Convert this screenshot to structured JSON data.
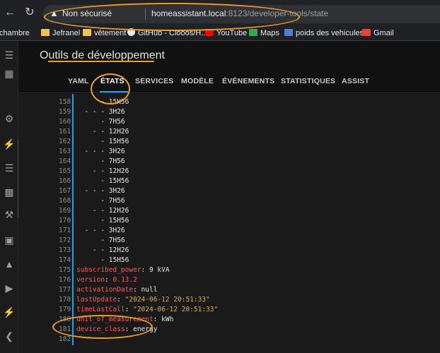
{
  "browser": {
    "back_icon": "arrow-left-icon",
    "reload_icon": "reload-icon",
    "security_label": "Non sécurisé",
    "url_host": "homeassistant.local",
    "url_rest": ":8123/developer-tools/state"
  },
  "bookmarks": [
    {
      "label": "chambre",
      "icon": "folder-icon"
    },
    {
      "label": "Jefranel",
      "icon": "folder-icon"
    },
    {
      "label": "vêtement",
      "icon": "folder-icon"
    },
    {
      "label": "GitHub - Clooos/H...",
      "icon": "github-icon"
    },
    {
      "label": "YouTube",
      "icon": "youtube-icon"
    },
    {
      "label": "Maps",
      "icon": "maps-icon"
    },
    {
      "label": "poids des vehicules...",
      "icon": "page-icon"
    },
    {
      "label": "Gmail",
      "icon": "gmail-icon"
    }
  ],
  "header": {
    "title": "Outils de développement"
  },
  "tabs": [
    {
      "label": "YAML"
    },
    {
      "label": "ÉTATS"
    },
    {
      "label": "SERVICES"
    },
    {
      "label": "MODÈLE"
    },
    {
      "label": "ÉVÉNEMENTS"
    },
    {
      "label": "STATISTIQUES"
    },
    {
      "label": "ASSIST"
    }
  ],
  "editor": {
    "lines": [
      {
        "n": "158",
        "text": "      - 15H56"
      },
      {
        "n": "159",
        "text": "  - - - 3H26"
      },
      {
        "n": "160",
        "text": "      - 7H56"
      },
      {
        "n": "161",
        "text": "    - - 12H26"
      },
      {
        "n": "162",
        "text": "      - 15H56"
      },
      {
        "n": "163",
        "text": "  - - - 3H26"
      },
      {
        "n": "164",
        "text": "      - 7H56"
      },
      {
        "n": "165",
        "text": "    - - 12H26"
      },
      {
        "n": "166",
        "text": "      - 15H56"
      },
      {
        "n": "167",
        "text": "  - - - 3H26"
      },
      {
        "n": "168",
        "text": "      - 7H56"
      },
      {
        "n": "169",
        "text": "    - - 12H26"
      },
      {
        "n": "170",
        "text": "      - 15H56"
      },
      {
        "n": "171",
        "text": "  - - - 3H26"
      },
      {
        "n": "172",
        "text": "      - 7H56"
      },
      {
        "n": "173",
        "text": "    - - 12H26"
      },
      {
        "n": "174",
        "text": "      - 15H56"
      },
      {
        "n": "175",
        "key": "subscribed_power",
        "value": " 9 kVA",
        "vtype": "plain"
      },
      {
        "n": "176",
        "key": "version",
        "value": " 0.13.2",
        "vtype": "key"
      },
      {
        "n": "177",
        "key": "activationDate",
        "value": " null",
        "vtype": "plain"
      },
      {
        "n": "178",
        "key": "lastUpdate",
        "value": " \"2024-06-12 20:51:33\"",
        "vtype": "str"
      },
      {
        "n": "179",
        "key": "timeLastCall",
        "value": " \"2024-06-12 20:51:33\"",
        "vtype": "str"
      },
      {
        "n": "180",
        "key": "unit_of_measurement",
        "value": " kWh",
        "vtype": "plain"
      },
      {
        "n": "181",
        "key": "device_class",
        "value": " energy",
        "vtype": "plain"
      },
      {
        "n": "182",
        "text": ""
      }
    ]
  },
  "sidebar": {
    "icons": [
      "menu-icon",
      "dashboard-icon",
      "settings-cog-icon",
      "puzzle-icon",
      "lightning-icon",
      "list-icon",
      "chart-icon",
      "wrench-icon",
      "hacs-icon",
      "history-icon",
      "media-icon",
      "energy-icon",
      "vscode-icon"
    ]
  }
}
